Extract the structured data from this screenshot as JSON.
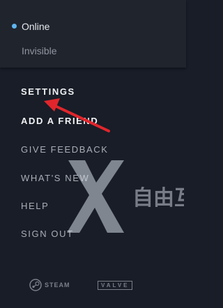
{
  "status_menu": {
    "online_label": "Online",
    "invisible_label": "Invisible"
  },
  "menu": {
    "settings": "SETTINGS",
    "add_friend": "ADD A FRIEND",
    "give_feedback": "GIVE FEEDBACK",
    "whats_new": "WHAT'S NEW",
    "help": "HELP",
    "sign_out": "SIGN OUT"
  },
  "footer": {
    "steam": "STEAM",
    "valve": "VALVE"
  },
  "colors": {
    "background": "#181d27",
    "status_panel": "#20242d",
    "online_dot": "#5fb4ee",
    "arrow": "#e0262c"
  },
  "watermark_text": "X 自由互联"
}
